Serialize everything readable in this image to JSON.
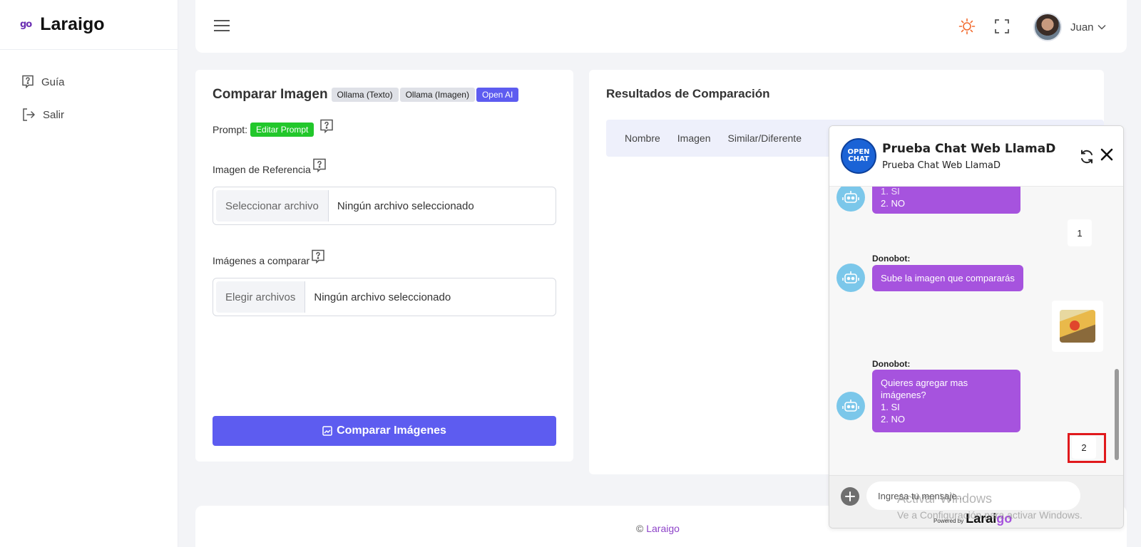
{
  "brand": {
    "mark": "go",
    "name": "Laraigo"
  },
  "sidebar": {
    "items": [
      {
        "label": "Guía",
        "icon": "help-icon"
      },
      {
        "label": "Salir",
        "icon": "logout-icon"
      }
    ]
  },
  "header": {
    "user_name": "Juan",
    "theme_icon": "sun-icon",
    "fullscreen_icon": "fullscreen-icon"
  },
  "compare": {
    "title": "Comparar Imagen",
    "tags": [
      "Ollama (Texto)",
      "Ollama (Imagen)",
      "Open AI"
    ],
    "active_tag": "Open AI",
    "prompt_label": "Prompt:",
    "edit_prompt_label": "Editar Prompt",
    "reference_label": "Imagen de Referencia",
    "reference_button": "Seleccionar archivo",
    "reference_value": "Ningún archivo seleccionado",
    "compare_label": "Imágenes a comparar",
    "compare_button": "Elegir archivos",
    "compare_value": "Ningún archivo seleccionado",
    "submit_label": "Comparar Imágenes"
  },
  "results": {
    "title": "Resultados de Comparación",
    "columns": [
      "Nombre",
      "Imagen",
      "Similar/Diferente"
    ]
  },
  "footer": {
    "copyright_symbol": "©",
    "link_text": "Laraigo"
  },
  "chat": {
    "logo_text": "OPEN CHAT",
    "title": "Prueba Chat Web LlamaD",
    "subtitle": "Prueba Chat Web LlamaD",
    "messages": {
      "bot_partial_line1": "1. SI",
      "bot_partial_line2": "2. NO",
      "user_reply_1": "1",
      "bot_sender_1": "Donobot:",
      "bot_msg_1": "Sube la imagen que compararás",
      "bot_sender_2": "Donobot:",
      "bot_msg_2_line1": "Quieres agregar mas imágenes?",
      "bot_msg_2_line2": "1. SI",
      "bot_msg_2_line3": "2. NO",
      "user_reply_2": "2"
    },
    "input_placeholder": "Ingresa tu mensaje...",
    "powered_by": "Powered by",
    "powered_brand_a": "Larai",
    "powered_brand_b": "go"
  },
  "watermark": {
    "line1": "Activar Windows",
    "line2": "Ve a Configuración para activar Windows."
  },
  "colors": {
    "primary": "#5d5cf0",
    "edit_prompt": "#22c72b",
    "chat_bubble": "#a653de",
    "theme_icon": "#f26a2e",
    "highlight": "#e0191c"
  }
}
